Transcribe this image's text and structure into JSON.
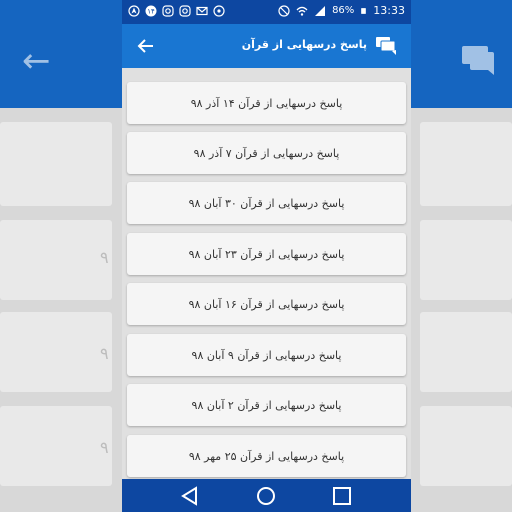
{
  "status_bar": {
    "time": "13:33",
    "battery": "86%",
    "left_icons": [
      "navigation-icon",
      "badge-14-icon",
      "instagram-icon",
      "instagram-icon",
      "gmail-icon",
      "location-icon"
    ],
    "right_icons": [
      "mute-icon",
      "wifi-icon",
      "signal-icon",
      "battery-icon"
    ]
  },
  "app_bar": {
    "title": "پاسخ درسهایی از قرآن",
    "back_icon": "arrow-back-icon",
    "title_icon": "chat-icon"
  },
  "list": [
    {
      "label": "پاسخ درسهایی از قرآن ۱۴ آذر ۹۸"
    },
    {
      "label": "پاسخ درسهایی از قرآن ۷ آذر ۹۸"
    },
    {
      "label": "پاسخ درسهایی از قرآن ۳۰ آبان ۹۸"
    },
    {
      "label": "پاسخ درسهایی از قرآن ۲۳ آبان ۹۸"
    },
    {
      "label": "پاسخ درسهایی از قرآن ۱۶ آبان ۹۸"
    },
    {
      "label": "پاسخ درسهایی از قرآن ۹ آبان ۹۸"
    },
    {
      "label": "پاسخ درسهایی از قرآن ۲ آبان ۹۸"
    },
    {
      "label": "پاسخ درسهایی از قرآن ۲۵ مهر ۹۸"
    }
  ],
  "nav_bar": {
    "buttons": [
      "back-triangle-icon",
      "home-circle-icon",
      "recents-square-icon"
    ]
  },
  "colors": {
    "status_bar": "#0d47a1",
    "app_bar": "#1976d2",
    "list_background": "#e0e0e0",
    "item_background": "#f5f5f5"
  }
}
